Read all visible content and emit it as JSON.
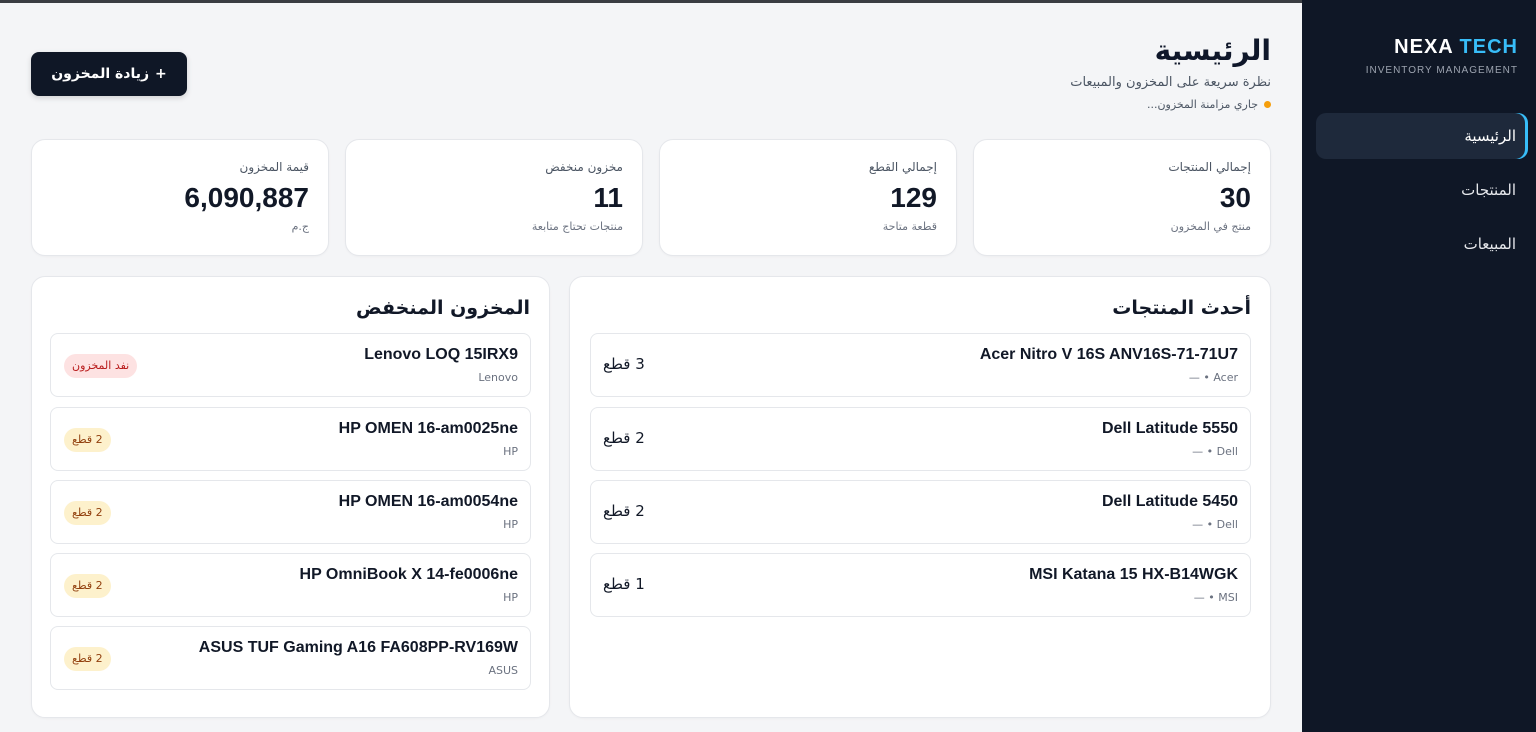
{
  "brand": {
    "name_main": "NEXA",
    "name_accent": "TECH",
    "subtitle": "INVENTORY MANAGEMENT"
  },
  "nav": {
    "items": [
      {
        "label": "الرئيسية",
        "active": true
      },
      {
        "label": "المنتجات",
        "active": false
      },
      {
        "label": "المبيعات",
        "active": false
      }
    ]
  },
  "header": {
    "title": "الرئيسية",
    "subtitle": "نظرة سريعة على المخزون والمبيعات",
    "sync_status": "جاري مزامنة المخزون..."
  },
  "actions": {
    "add_stock_label": "زيادة المخزون",
    "add_icon": "+"
  },
  "stats": [
    {
      "label": "إجمالي المنتجات",
      "value": "30",
      "note": "منتج في المخزون"
    },
    {
      "label": "إجمالي القطع",
      "value": "129",
      "note": "قطعة متاحة"
    },
    {
      "label": "مخزون منخفض",
      "value": "11",
      "note": "منتجات تحتاج متابعة"
    },
    {
      "label": "قيمة المخزون",
      "value": "6,090,887",
      "note": "ج.م"
    }
  ],
  "latest": {
    "title": "أحدث المنتجات",
    "items": [
      {
        "name": "Acer Nitro V 16S ANV16S-71-71U7",
        "meta": "Acer • —",
        "qty": "3 قطع"
      },
      {
        "name": "Dell Latitude 5550",
        "meta": "Dell • —",
        "qty": "2 قطع"
      },
      {
        "name": "Dell Latitude 5450",
        "meta": "Dell • —",
        "qty": "2 قطع"
      },
      {
        "name": "MSI Katana 15 HX-B14WGK",
        "meta": "MSI • —",
        "qty": "1 قطع"
      }
    ]
  },
  "low_stock": {
    "title": "المخزون المنخفض",
    "items": [
      {
        "name": "Lenovo LOQ 15IRX9",
        "brand": "Lenovo",
        "badge": "نفد المخزون",
        "status": "out"
      },
      {
        "name": "HP OMEN 16-am0025ne",
        "brand": "HP",
        "badge": "2 قطع",
        "status": "low"
      },
      {
        "name": "HP OMEN 16-am0054ne",
        "brand": "HP",
        "badge": "2 قطع",
        "status": "low"
      },
      {
        "name": "HP OmniBook X 14-fe0006ne",
        "brand": "HP",
        "badge": "2 قطع",
        "status": "low"
      },
      {
        "name": "ASUS TUF Gaming A16 FA608PP-RV169W",
        "brand": "ASUS",
        "badge": "2 قطع",
        "status": "low"
      }
    ]
  },
  "colors": {
    "sidebar_bg": "#0f1726",
    "accent": "#38bdf8",
    "warning_dot": "#f59e0b",
    "out_badge": "#fde2e2",
    "low_badge": "#fdf1cc"
  }
}
